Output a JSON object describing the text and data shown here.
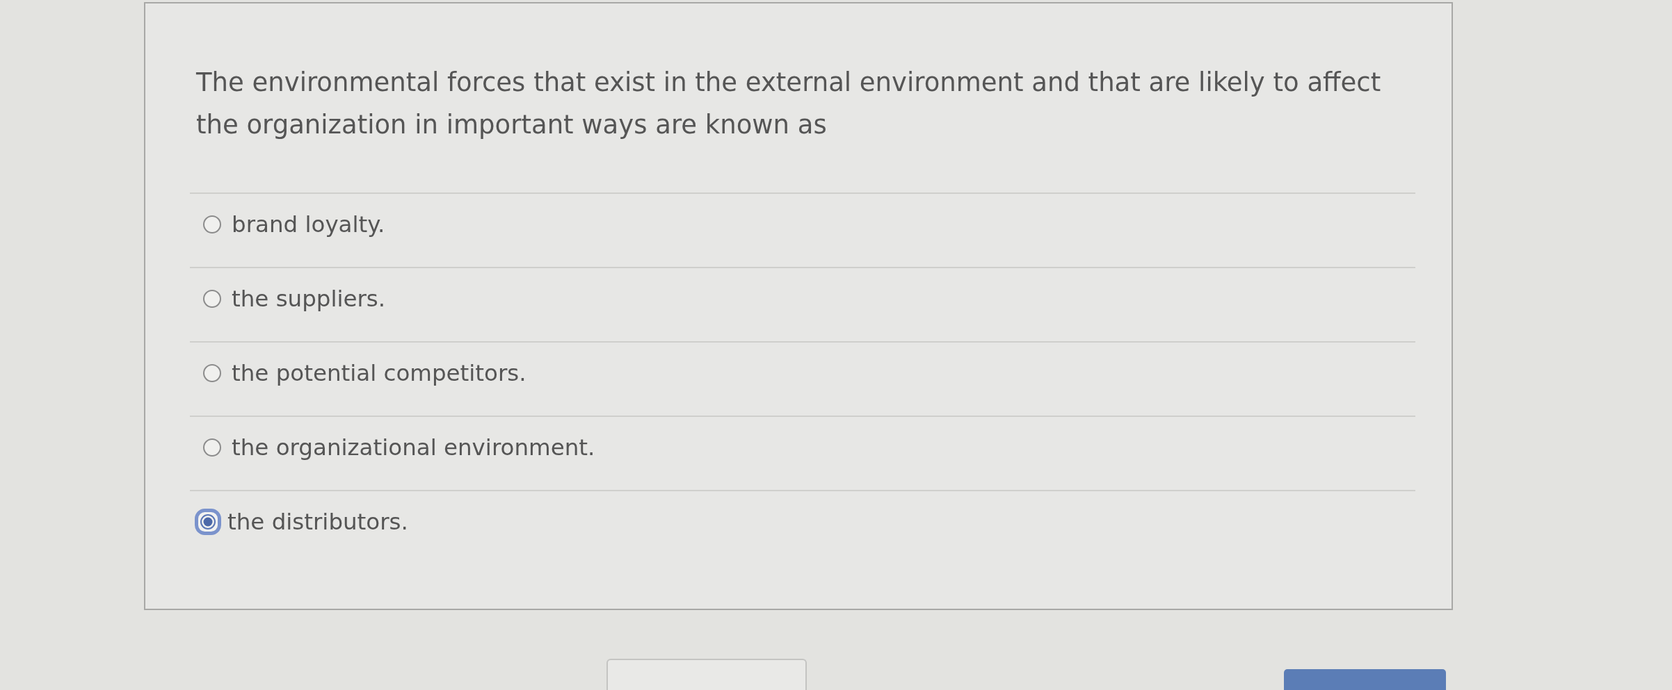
{
  "question": {
    "text": "The environmental forces that exist in the external environment and that are likely to affect the organization in important ways are known as"
  },
  "options": [
    {
      "label": "brand loyalty.",
      "selected": false
    },
    {
      "label": "the suppliers.",
      "selected": false
    },
    {
      "label": "the potential competitors.",
      "selected": false
    },
    {
      "label": "the organizational environment.",
      "selected": false
    },
    {
      "label": "the distributors.",
      "selected": true
    }
  ],
  "buttons": [
    {
      "kind": "secondary"
    },
    {
      "kind": "primary"
    }
  ]
}
